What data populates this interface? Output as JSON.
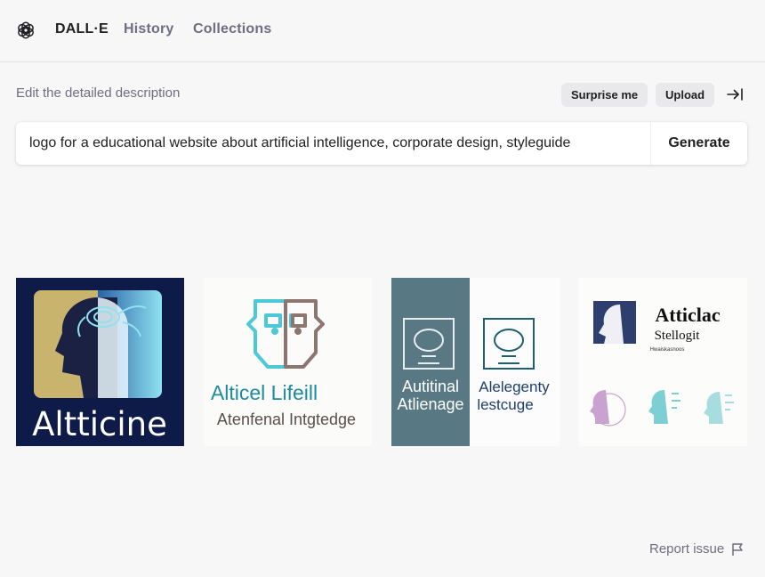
{
  "header": {
    "brand": "DALL·E",
    "nav": [
      {
        "label": "History"
      },
      {
        "label": "Collections"
      }
    ],
    "logo_icon": "openai-logo-icon"
  },
  "prompt": {
    "hint": "Edit the detailed description",
    "surprise_label": "Surprise me",
    "upload_label": "Upload",
    "collapse_icon": "collapse-right-icon",
    "value": "logo for a educational website about artificial intelligence, corporate design, styleguide",
    "generate_label": "Generate"
  },
  "results": [
    {
      "lines": [
        "Altticine"
      ]
    },
    {
      "lines": [
        "Alticel Lifeill",
        "Atenfenal Intgtedge"
      ]
    },
    {
      "lines": [
        "Autitinal",
        "Atlienage",
        "Alelegenty",
        "lestcuge"
      ]
    },
    {
      "lines": [
        "Atticlac",
        "Stellogit",
        "Hwaiskasnoos"
      ]
    }
  ],
  "footer": {
    "report_label": "Report issue",
    "report_icon": "flag-icon"
  },
  "colors": {
    "background": "#f7f7f8",
    "text": "#202123",
    "muted": "#6e6e80",
    "pill": "#e9e9ec"
  }
}
